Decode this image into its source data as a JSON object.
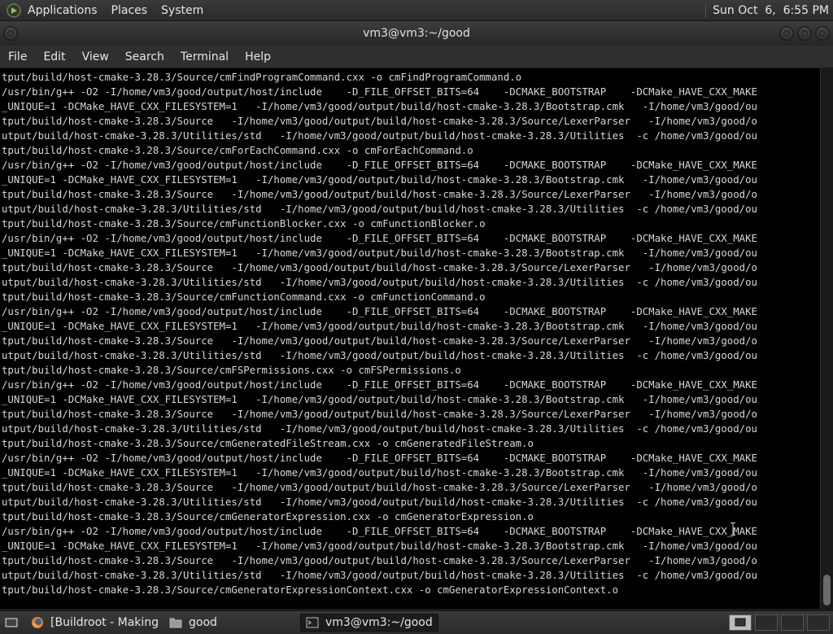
{
  "top_panel": {
    "menus": [
      "Applications",
      "Places",
      "System"
    ],
    "clock": "Sun Oct  6,  6:55 PM"
  },
  "window": {
    "title": "vm3@vm3:~/good"
  },
  "menubar": {
    "items": [
      "File",
      "Edit",
      "View",
      "Search",
      "Terminal",
      "Help"
    ]
  },
  "terminal": {
    "lines": [
      "tput/build/host-cmake-3.28.3/Source/cmFindProgramCommand.cxx -o cmFindProgramCommand.o",
      "/usr/bin/g++ -O2 -I/home/vm3/good/output/host/include    -D_FILE_OFFSET_BITS=64    -DCMAKE_BOOTSTRAP    -DCMake_HAVE_CXX_MAKE",
      "_UNIQUE=1 -DCMake_HAVE_CXX_FILESYSTEM=1   -I/home/vm3/good/output/build/host-cmake-3.28.3/Bootstrap.cmk   -I/home/vm3/good/ou",
      "tput/build/host-cmake-3.28.3/Source   -I/home/vm3/good/output/build/host-cmake-3.28.3/Source/LexerParser   -I/home/vm3/good/o",
      "utput/build/host-cmake-3.28.3/Utilities/std   -I/home/vm3/good/output/build/host-cmake-3.28.3/Utilities  -c /home/vm3/good/ou",
      "tput/build/host-cmake-3.28.3/Source/cmForEachCommand.cxx -o cmForEachCommand.o",
      "/usr/bin/g++ -O2 -I/home/vm3/good/output/host/include    -D_FILE_OFFSET_BITS=64    -DCMAKE_BOOTSTRAP    -DCMake_HAVE_CXX_MAKE",
      "_UNIQUE=1 -DCMake_HAVE_CXX_FILESYSTEM=1   -I/home/vm3/good/output/build/host-cmake-3.28.3/Bootstrap.cmk   -I/home/vm3/good/ou",
      "tput/build/host-cmake-3.28.3/Source   -I/home/vm3/good/output/build/host-cmake-3.28.3/Source/LexerParser   -I/home/vm3/good/o",
      "utput/build/host-cmake-3.28.3/Utilities/std   -I/home/vm3/good/output/build/host-cmake-3.28.3/Utilities  -c /home/vm3/good/ou",
      "tput/build/host-cmake-3.28.3/Source/cmFunctionBlocker.cxx -o cmFunctionBlocker.o",
      "/usr/bin/g++ -O2 -I/home/vm3/good/output/host/include    -D_FILE_OFFSET_BITS=64    -DCMAKE_BOOTSTRAP    -DCMake_HAVE_CXX_MAKE",
      "_UNIQUE=1 -DCMake_HAVE_CXX_FILESYSTEM=1   -I/home/vm3/good/output/build/host-cmake-3.28.3/Bootstrap.cmk   -I/home/vm3/good/ou",
      "tput/build/host-cmake-3.28.3/Source   -I/home/vm3/good/output/build/host-cmake-3.28.3/Source/LexerParser   -I/home/vm3/good/o",
      "utput/build/host-cmake-3.28.3/Utilities/std   -I/home/vm3/good/output/build/host-cmake-3.28.3/Utilities  -c /home/vm3/good/ou",
      "tput/build/host-cmake-3.28.3/Source/cmFunctionCommand.cxx -o cmFunctionCommand.o",
      "/usr/bin/g++ -O2 -I/home/vm3/good/output/host/include    -D_FILE_OFFSET_BITS=64    -DCMAKE_BOOTSTRAP    -DCMake_HAVE_CXX_MAKE",
      "_UNIQUE=1 -DCMake_HAVE_CXX_FILESYSTEM=1   -I/home/vm3/good/output/build/host-cmake-3.28.3/Bootstrap.cmk   -I/home/vm3/good/ou",
      "tput/build/host-cmake-3.28.3/Source   -I/home/vm3/good/output/build/host-cmake-3.28.3/Source/LexerParser   -I/home/vm3/good/o",
      "utput/build/host-cmake-3.28.3/Utilities/std   -I/home/vm3/good/output/build/host-cmake-3.28.3/Utilities  -c /home/vm3/good/ou",
      "tput/build/host-cmake-3.28.3/Source/cmFSPermissions.cxx -o cmFSPermissions.o",
      "/usr/bin/g++ -O2 -I/home/vm3/good/output/host/include    -D_FILE_OFFSET_BITS=64    -DCMAKE_BOOTSTRAP    -DCMake_HAVE_CXX_MAKE",
      "_UNIQUE=1 -DCMake_HAVE_CXX_FILESYSTEM=1   -I/home/vm3/good/output/build/host-cmake-3.28.3/Bootstrap.cmk   -I/home/vm3/good/ou",
      "tput/build/host-cmake-3.28.3/Source   -I/home/vm3/good/output/build/host-cmake-3.28.3/Source/LexerParser   -I/home/vm3/good/o",
      "utput/build/host-cmake-3.28.3/Utilities/std   -I/home/vm3/good/output/build/host-cmake-3.28.3/Utilities  -c /home/vm3/good/ou",
      "tput/build/host-cmake-3.28.3/Source/cmGeneratedFileStream.cxx -o cmGeneratedFileStream.o",
      "/usr/bin/g++ -O2 -I/home/vm3/good/output/host/include    -D_FILE_OFFSET_BITS=64    -DCMAKE_BOOTSTRAP    -DCMake_HAVE_CXX_MAKE",
      "_UNIQUE=1 -DCMake_HAVE_CXX_FILESYSTEM=1   -I/home/vm3/good/output/build/host-cmake-3.28.3/Bootstrap.cmk   -I/home/vm3/good/ou",
      "tput/build/host-cmake-3.28.3/Source   -I/home/vm3/good/output/build/host-cmake-3.28.3/Source/LexerParser   -I/home/vm3/good/o",
      "utput/build/host-cmake-3.28.3/Utilities/std   -I/home/vm3/good/output/build/host-cmake-3.28.3/Utilities  -c /home/vm3/good/ou",
      "tput/build/host-cmake-3.28.3/Source/cmGeneratorExpression.cxx -o cmGeneratorExpression.o",
      "/usr/bin/g++ -O2 -I/home/vm3/good/output/host/include    -D_FILE_OFFSET_BITS=64    -DCMAKE_BOOTSTRAP    -DCMake_HAVE_CXX_MAKE",
      "_UNIQUE=1 -DCMake_HAVE_CXX_FILESYSTEM=1   -I/home/vm3/good/output/build/host-cmake-3.28.3/Bootstrap.cmk   -I/home/vm3/good/ou",
      "tput/build/host-cmake-3.28.3/Source   -I/home/vm3/good/output/build/host-cmake-3.28.3/Source/LexerParser   -I/home/vm3/good/o",
      "utput/build/host-cmake-3.28.3/Utilities/std   -I/home/vm3/good/output/build/host-cmake-3.28.3/Utilities  -c /home/vm3/good/ou",
      "tput/build/host-cmake-3.28.3/Source/cmGeneratorExpressionContext.cxx -o cmGeneratorExpressionContext.o"
    ]
  },
  "taskbar": {
    "tasks": [
      {
        "label": "[Buildroot - Making ...",
        "icon": "firefox-icon"
      },
      {
        "label": "good",
        "icon": "folder-icon"
      },
      {
        "label": "vm3@vm3:~/good",
        "icon": "terminal-icon"
      }
    ]
  },
  "colors": {
    "terminal_bg": "#000000",
    "terminal_fg": "#d8d8d8",
    "panel_bg": "#2f2f2f"
  }
}
